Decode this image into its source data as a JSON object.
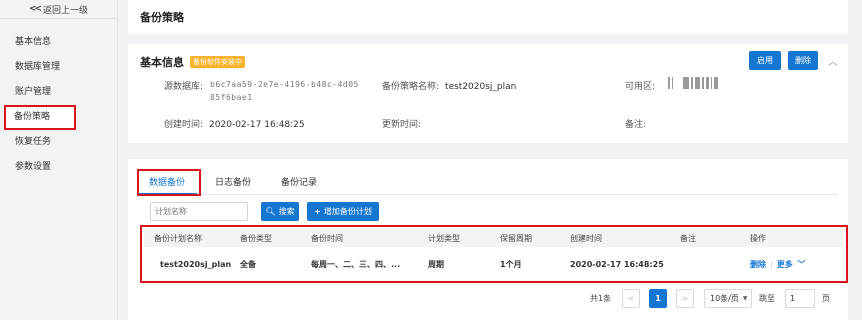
{
  "sidebar": {
    "back_label": "返回上一级",
    "items": [
      {
        "label": "基本信息"
      },
      {
        "label": "数据库管理"
      },
      {
        "label": "账户管理"
      },
      {
        "label": "备份策略"
      },
      {
        "label": "恢复任务"
      },
      {
        "label": "参数设置"
      }
    ]
  },
  "page": {
    "title": "备份策略"
  },
  "basic": {
    "title": "基本信息",
    "badge": "备份软件安装中",
    "enable_label": "启用",
    "delete_label": "删除",
    "fields": {
      "source_label": "源数据库:",
      "source_value_line1": "b6c7aa59-2e7e-4196-b48c-4d05",
      "source_value_line2": "85f6bae1",
      "policy_name_label": "备份策略名称:",
      "policy_name_value": "test2020sj_plan",
      "zone_label": "可用区:",
      "created_label": "创建时间:",
      "created_value": "2020-02-17 16:48:25",
      "updated_label": "更新时间:",
      "updated_value": "",
      "remark_label": "备注:",
      "remark_value": ""
    }
  },
  "tabs": [
    {
      "label": "数据备份",
      "active": true
    },
    {
      "label": "日志备份",
      "active": false
    },
    {
      "label": "备份记录",
      "active": false
    }
  ],
  "search": {
    "placeholder": "计划名称",
    "search_label": "搜索",
    "add_label": "增加备份计划"
  },
  "table": {
    "headers": [
      "备份计划名称",
      "备份类型",
      "备份时间",
      "计划类型",
      "保留周期",
      "创建时间",
      "备注",
      "操作"
    ],
    "rows": [
      {
        "name": "test2020sj_plan",
        "type": "全备",
        "time": "每周一、二、三、四、...",
        "plan_type": "周期",
        "retention": "1个月",
        "created": "2020-02-17 16:48:25",
        "remark": "",
        "delete_label": "删除",
        "more_label": "更多"
      }
    ]
  },
  "pager": {
    "total": "共1条",
    "current_page": "1",
    "page_size": "10条/页",
    "jump_label": "跳至",
    "jump_value": "1",
    "page_unit": "页"
  },
  "colors": {
    "primary": "#1677d2",
    "badge": "#f7b32b",
    "highlight": "#d9141c"
  }
}
